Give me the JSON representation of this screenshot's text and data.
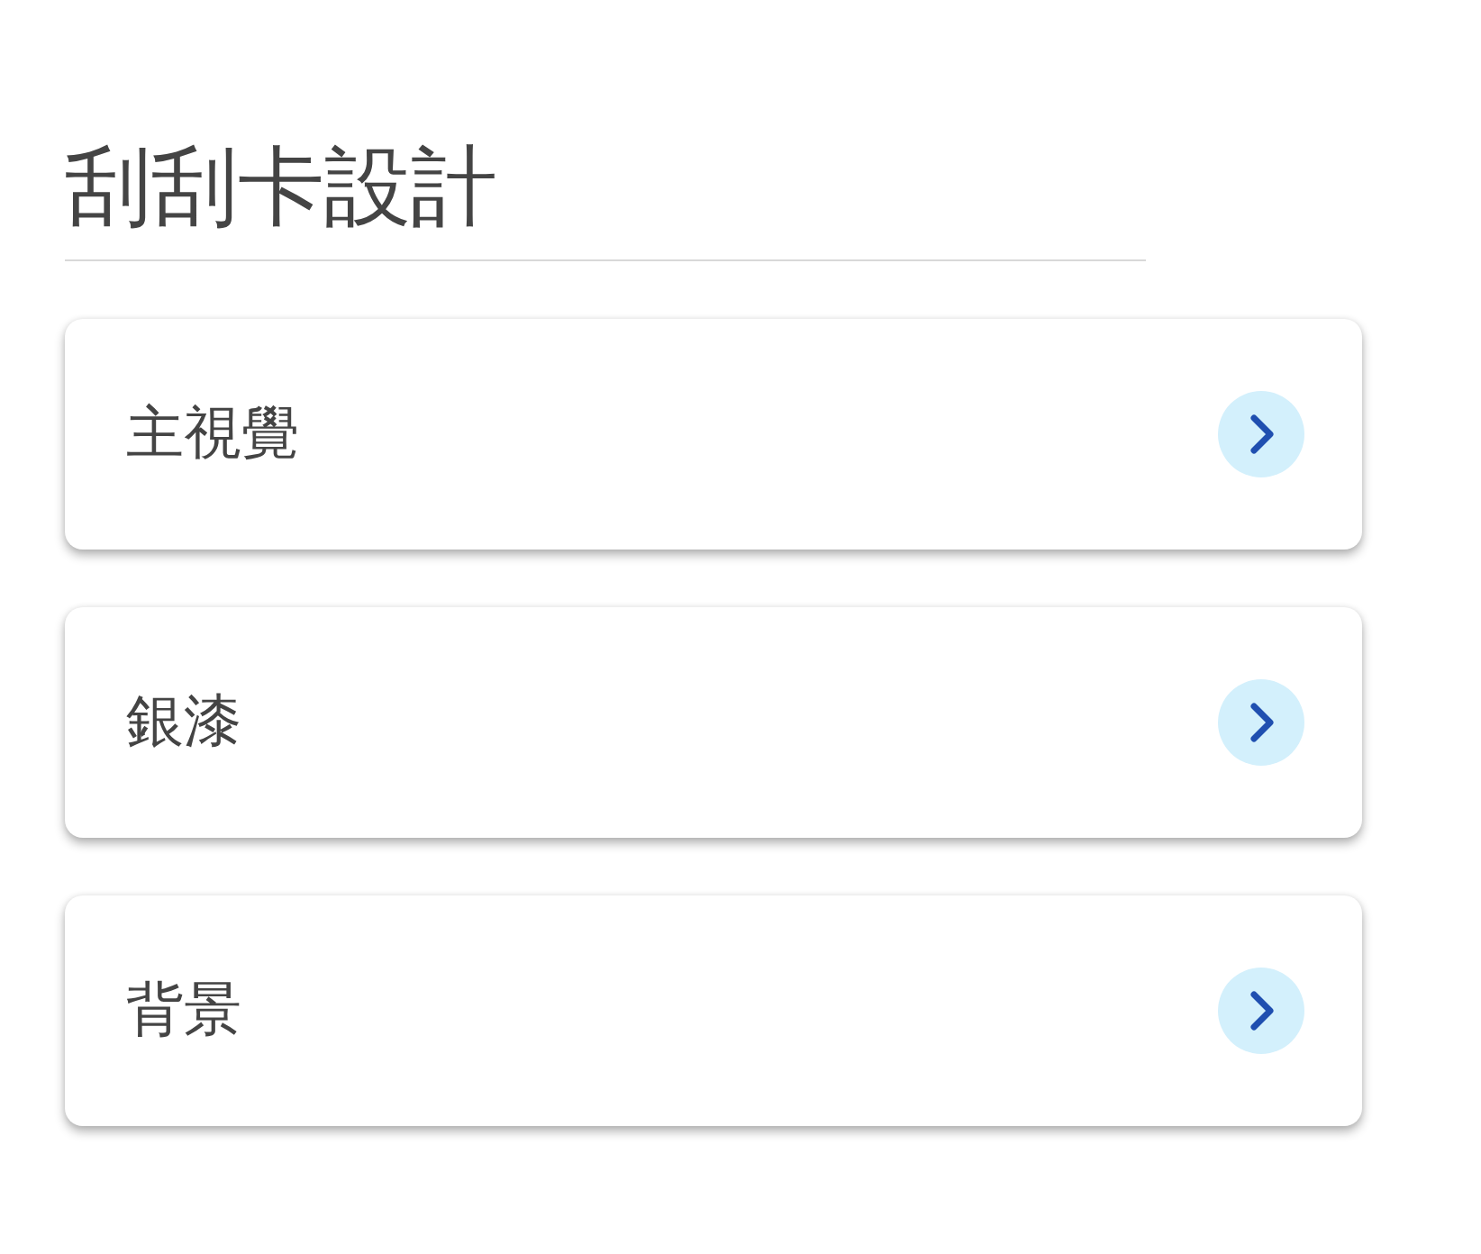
{
  "title": "刮刮卡設計",
  "items": [
    {
      "label": "主視覺"
    },
    {
      "label": "銀漆"
    },
    {
      "label": "背景"
    }
  ]
}
